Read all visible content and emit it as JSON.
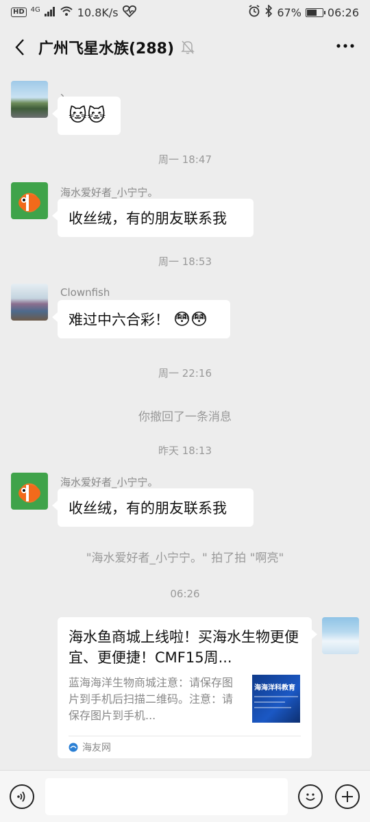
{
  "status_bar": {
    "hd": "HD",
    "network": "4G",
    "speed": "10.8K/s",
    "battery": "67%",
    "battery_level": 0.67,
    "time": "06:26"
  },
  "header": {
    "title": "广州飞星水族(288)"
  },
  "messages": [
    {
      "sender": "、",
      "emoji": "🐱🐱"
    },
    {
      "time": "周一 18:47"
    },
    {
      "sender": "海水爱好者_小宁宁。",
      "text": "收丝绒，有的朋友联系我"
    },
    {
      "time": "周一 18:53"
    },
    {
      "sender": "Clownfish",
      "text": "难过中六合彩！",
      "emoji": "😳😳"
    },
    {
      "time": "周一 22:16"
    },
    {
      "system": "你撤回了一条消息"
    },
    {
      "time": "昨天 18:13"
    },
    {
      "sender": "海水爱好者_小宁宁。",
      "text": "收丝绒，有的朋友联系我"
    },
    {
      "system": "\"海水爱好者_小宁宁。\" 拍了拍 \"啊亮\""
    },
    {
      "time": "06:26"
    }
  ],
  "card": {
    "title": "海水鱼商城上线啦！买海水生物更便宜、更便捷！CMF15周...",
    "description": "蓝海海洋生物商城注意：请保存图片到手机后扫描二维码。注意：请保存图片到手机...",
    "thumb_text": "海海洋科教育",
    "source": "海友网"
  },
  "colors": {
    "background": "#ededed",
    "bubble": "#ffffff",
    "muted_text": "#999999"
  }
}
